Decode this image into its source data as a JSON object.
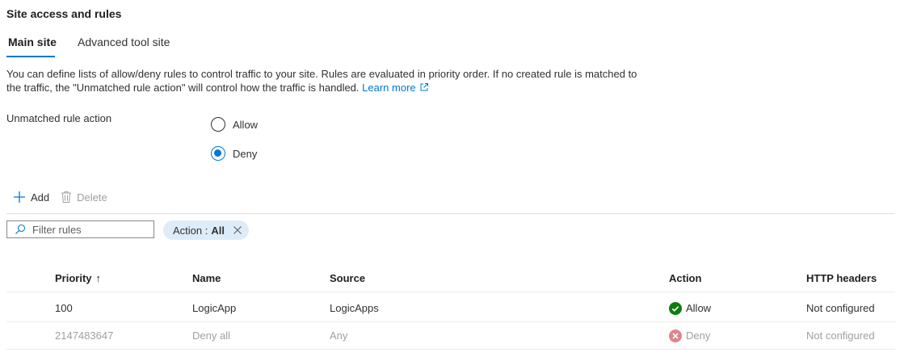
{
  "section": {
    "title": "Site access and rules"
  },
  "tabs": [
    {
      "label": "Main site",
      "active": true
    },
    {
      "label": "Advanced tool site",
      "active": false
    }
  ],
  "description": {
    "text": "You can define lists of allow/deny rules to control traffic to your site. Rules are evaluated in priority order. If no created rule is matched to the traffic, the \"Unmatched rule action\" will control how the traffic is handled.",
    "link_label": "Learn more",
    "link_icon": "external-link-icon"
  },
  "unmatched_rule_action": {
    "label": "Unmatched rule action",
    "options": [
      {
        "label": "Allow",
        "selected": false
      },
      {
        "label": "Deny",
        "selected": true
      }
    ]
  },
  "toolbar": {
    "add_label": "Add",
    "add_icon": "plus-icon",
    "delete_label": "Delete",
    "delete_icon": "trash-icon",
    "delete_enabled": false
  },
  "filter": {
    "placeholder": "Filter rules",
    "value": "",
    "pill_key": "Action :",
    "pill_value": "All"
  },
  "table": {
    "columns": {
      "priority": "Priority",
      "priority_sort": "↑",
      "name": "Name",
      "source": "Source",
      "action": "Action",
      "http_headers": "HTTP headers"
    },
    "rows": [
      {
        "priority": "100",
        "name": "LogicApp",
        "source": "LogicApps",
        "action": "Allow",
        "action_icon": "check-circle-icon",
        "http_headers": "Not configured",
        "muted": false
      },
      {
        "priority": "2147483647",
        "name": "Deny all",
        "source": "Any",
        "action": "Deny",
        "action_icon": "error-circle-icon",
        "http_headers": "Not configured",
        "muted": true
      }
    ]
  },
  "colors": {
    "accent": "#0078d4",
    "allow_green": "#107c10",
    "deny_red": "#e0858a",
    "pill_bg": "#deecf9"
  }
}
